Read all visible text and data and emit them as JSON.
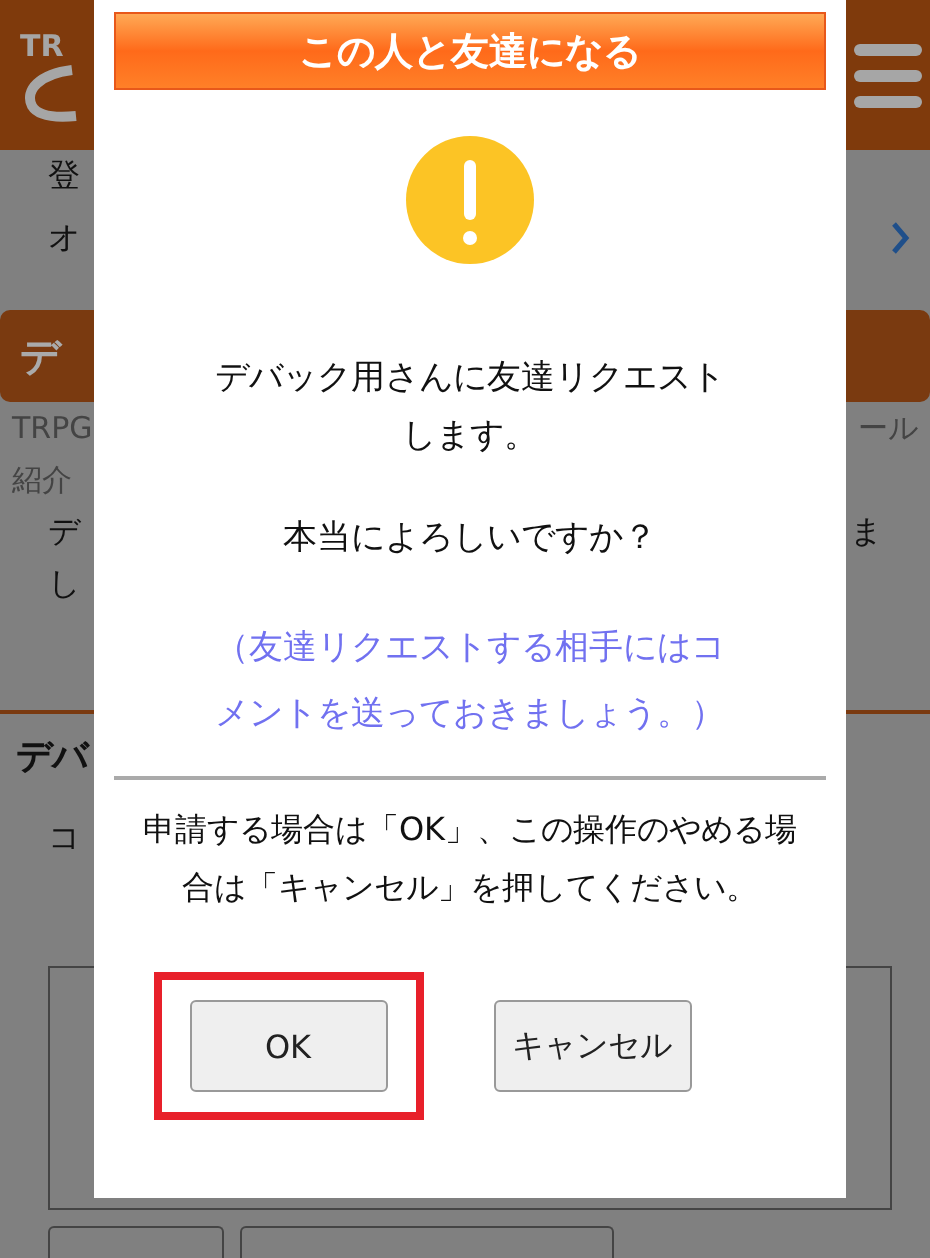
{
  "background": {
    "header": {
      "logo_fragment": "TR"
    },
    "rows": [
      {
        "kind": "text",
        "left": "登",
        "right": ""
      },
      {
        "kind": "link",
        "left": "オ",
        "right": ""
      },
      {
        "kind": "banner",
        "left": "デ",
        "right": ""
      },
      {
        "kind": "small",
        "left": "TRPG",
        "right": "ール"
      },
      {
        "kind": "small",
        "left": "紹介",
        "right": ""
      },
      {
        "kind": "text",
        "left": "デ",
        "right": "ま"
      },
      {
        "kind": "text",
        "left": "し",
        "right": ""
      },
      {
        "kind": "heading",
        "left": "デバ",
        "right": ""
      },
      {
        "kind": "label",
        "left": "コ",
        "right": ""
      }
    ]
  },
  "dialog": {
    "title": "この人と友達になる",
    "message": "デバック用さんに友達リクエストします。",
    "question": "本当によろしいですか？",
    "hint": "（友達リクエストする相手にはコメントを送っておきましょう。）",
    "instruction": "申請する場合は「OK」、この操作のやめる場合は「キャンセル」を押してください。",
    "buttons": [
      {
        "label": "OK",
        "highlighted": true
      },
      {
        "label": "キャンセル",
        "highlighted": false
      }
    ]
  }
}
